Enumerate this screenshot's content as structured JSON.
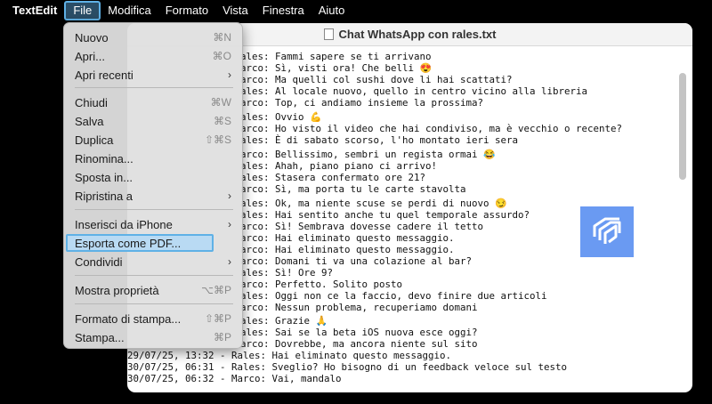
{
  "menubar": {
    "app": "TextEdit",
    "items": [
      "File",
      "Modifica",
      "Formato",
      "Vista",
      "Finestra",
      "Aiuto"
    ]
  },
  "window": {
    "title": "Chat WhatsApp con rales.txt",
    "lines": [
      "ales: Fammi sapere se ti arrivano",
      "arco: Sì, visti ora! Che belli 😍",
      "arco: Ma quelli col sushi dove li hai scattati?",
      "ales: Al locale nuovo, quello in centro vicino alla libreria",
      "arco: Top, ci andiamo insieme la prossima?",
      "ales: Ovvio 💪",
      "arco: Ho visto il video che hai condiviso, ma è vecchio o recente?",
      "ales: È di sabato scorso, l'ho montato ieri sera",
      "arco: Bellissimo, sembri un regista ormai 😂",
      "ales: Ahah, piano piano ci arrivo!",
      "ales: Stasera confermato ore 21?",
      "arco: Sì, ma porta tu le carte stavolta",
      "ales: Ok, ma niente scuse se perdi di nuovo 😏",
      "ales: Hai sentito anche tu quel temporale assurdo?",
      "arco: Sì! Sembrava dovesse cadere il tetto",
      "arco: Hai eliminato questo messaggio.",
      "arco: Hai eliminato questo messaggio.",
      "arco: Domani ti va una colazione al bar?",
      "ales: Sì! Ore 9?",
      "arco: Perfetto. Solito posto",
      "ales: Oggi non ce la faccio, devo finire due articoli",
      "arco: Nessun problema, recuperiamo domani",
      "ales: Grazie 🙏",
      "ales: Sai se la beta iOS nuova esce oggi?",
      "arco: Dovrebbe, ma ancora niente sul sito",
      "29/07/25, 13:32 - Rales: Hai eliminato questo messaggio.",
      "30/07/25, 06:31 - Rales: Sveglio? Ho bisogno di un feedback veloce sul testo",
      "30/07/25, 06:32 - Marco: Vai, mandalo"
    ]
  },
  "file_menu": {
    "items": [
      {
        "label": "Nuovo",
        "shortcut": "⌘N"
      },
      {
        "label": "Apri...",
        "shortcut": "⌘O"
      },
      {
        "label": "Apri recenti",
        "shortcut": "›"
      },
      {
        "label": "Chiudi",
        "shortcut": "⌘W"
      },
      {
        "label": "Salva",
        "shortcut": "⌘S"
      },
      {
        "label": "Duplica",
        "shortcut": "⇧⌘S"
      },
      {
        "label": "Rinomina...",
        "shortcut": ""
      },
      {
        "label": "Sposta in...",
        "shortcut": ""
      },
      {
        "label": "Ripristina a",
        "shortcut": "›"
      },
      {
        "label": "Inserisci da iPhone",
        "shortcut": "›"
      },
      {
        "label": "Esporta come PDF...",
        "shortcut": ""
      },
      {
        "label": "Condividi",
        "shortcut": "›"
      },
      {
        "label": "Mostra proprietà",
        "shortcut": "⌥⌘P"
      },
      {
        "label": "Formato di stampa...",
        "shortcut": "⇧⌘P"
      },
      {
        "label": "Stampa...",
        "shortcut": "⌘P"
      }
    ]
  },
  "colors": {
    "menu_highlight_border": "#5fb1e6",
    "menu_highlight_fill": "#b9daf3",
    "logo": "#6a9af2"
  }
}
